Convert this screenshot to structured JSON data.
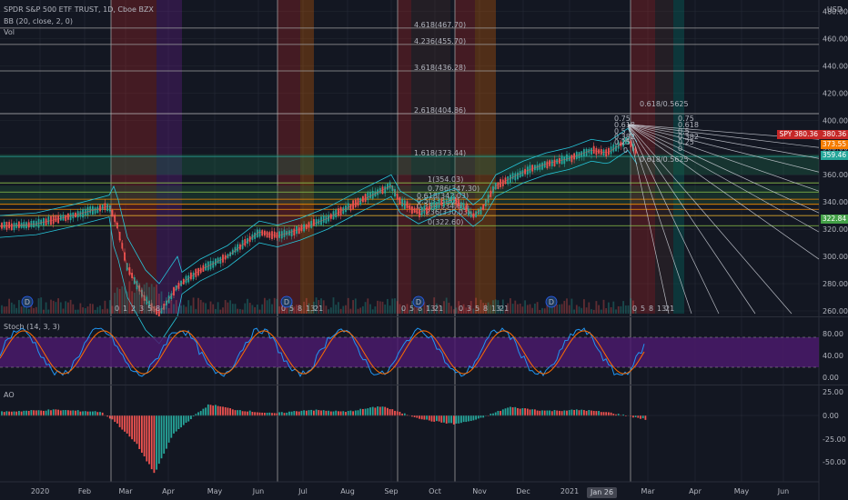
{
  "legend": {
    "symbol_line": "SPDR S&P 500 ETF TRUST, 1D, Cboe BZX",
    "bb": "BB (20, close, 2, 0)",
    "vol": "Vol",
    "stoch": "Stoch (14, 3, 3)",
    "ao": "AO"
  },
  "currency": "USD",
  "price_axis": [
    "480.00",
    "460.00",
    "440.00",
    "420.00",
    "400.00",
    "380.00",
    "360.00",
    "340.00",
    "320.00",
    "300.00",
    "280.00",
    "260.00"
  ],
  "stoch_axis": [
    "80.00",
    "40.00",
    "0.00"
  ],
  "ao_axis": [
    "25.00",
    "0.00",
    "-25.00",
    "-50.00"
  ],
  "time_axis": [
    "2020",
    "Feb",
    "Mar",
    "Apr",
    "May",
    "Jun",
    "Jul",
    "Aug",
    "Sep",
    "Oct",
    "Nov",
    "Dec",
    "2021",
    "Mar",
    "Apr",
    "May",
    "Jun"
  ],
  "crosshair_date": "Jan 26",
  "price_tags": [
    {
      "label": "SPY",
      "value": "380.36",
      "color": "#c62828"
    },
    {
      "value": "373.55",
      "color": "#f57c00"
    },
    {
      "value": "359.46",
      "color": "#26a69a"
    },
    {
      "value": "322.84",
      "color": "#43a047"
    }
  ],
  "fib_levels": [
    "4.618(467.70)",
    "4.236(455.70)",
    "3.618(436.28)",
    "2.618(404.86)",
    "1.618(373.44)",
    "1(354.03)",
    "0.786(347.30)",
    "0.618(342.03)",
    "0.5(338.32)",
    "0.382(334.61)",
    "0.236(330.03)",
    "0(322.60)"
  ],
  "fib_time_labels": [
    [
      "0",
      "1",
      "2",
      "3",
      "5",
      "8"
    ],
    [
      "0",
      "5",
      "8",
      "13",
      "21"
    ],
    [
      "0",
      "5",
      "8",
      "13",
      "21"
    ],
    [
      "0",
      "3",
      "5",
      "8",
      "13",
      "21"
    ],
    [
      "0",
      "5",
      "8",
      "13",
      "21"
    ]
  ],
  "gann_labels": [
    "0.75",
    "0.618",
    "0.5",
    "0.382",
    "0.25",
    "0"
  ],
  "gann_top": "0.618/0.5625",
  "gann_bottom": "0.618/0.5625",
  "dividend_marker": "D",
  "colors": {
    "bg": "#131722",
    "grid": "#2a2e39",
    "up": "#26a69a",
    "down": "#ef5350",
    "bb": "#26c6da",
    "fib": "#ffeb3b",
    "gann": "#d1d4dc",
    "stoch_band": "#4a1a6b"
  }
}
